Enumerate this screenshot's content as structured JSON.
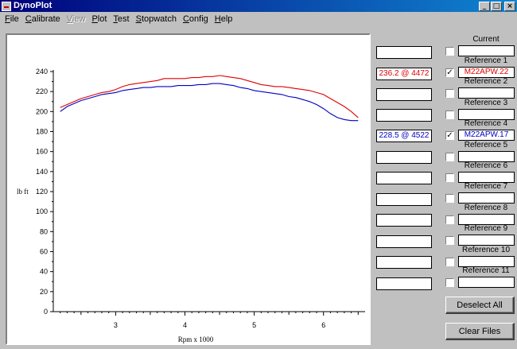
{
  "window": {
    "title": "DynoPlot",
    "min": "_",
    "max": "□",
    "close": "×"
  },
  "menu": [
    {
      "label": "File",
      "u": "F",
      "rest": "ile",
      "disabled": false
    },
    {
      "label": "Calibrate",
      "u": "C",
      "rest": "alibrate",
      "disabled": false
    },
    {
      "label": "View",
      "u": "V",
      "rest": "iew",
      "disabled": true
    },
    {
      "label": "Plot",
      "u": "P",
      "rest": "lot",
      "disabled": false
    },
    {
      "label": "Test",
      "u": "T",
      "rest": "est",
      "disabled": false
    },
    {
      "label": "Stopwatch",
      "u": "S",
      "rest": "topwatch",
      "disabled": false
    },
    {
      "label": "Config",
      "u": "C",
      "rest": "onfig",
      "disabled": false
    },
    {
      "label": "Help",
      "u": "H",
      "rest": "elp",
      "disabled": false
    }
  ],
  "readouts": [
    "",
    "236.2 @ 4472",
    "",
    "",
    "228.5 @ 4522",
    "",
    "",
    "",
    "",
    "",
    "",
    ""
  ],
  "readout_colors": [
    "#000000",
    "#e00000",
    "#000000",
    "#000000",
    "#0000c0",
    "#000000",
    "#000000",
    "#000000",
    "#000000",
    "#000000",
    "#000000",
    "#000000"
  ],
  "current": {
    "label": "Current",
    "value": ""
  },
  "references": [
    {
      "label": "Reference 1",
      "checked": true,
      "value": "M22APW.22",
      "color": "#e00000"
    },
    {
      "label": "Reference 2",
      "checked": false,
      "value": "",
      "color": "#000000"
    },
    {
      "label": "Reference 3",
      "checked": false,
      "value": "",
      "color": "#000000"
    },
    {
      "label": "Reference 4",
      "checked": true,
      "value": "M22APW.17",
      "color": "#0000c0"
    },
    {
      "label": "Reference 5",
      "checked": false,
      "value": "",
      "color": "#000000"
    },
    {
      "label": "Reference 6",
      "checked": false,
      "value": "",
      "color": "#000000"
    },
    {
      "label": "Reference 7",
      "checked": false,
      "value": "",
      "color": "#000000"
    },
    {
      "label": "Reference 8",
      "checked": false,
      "value": "",
      "color": "#000000"
    },
    {
      "label": "Reference 9",
      "checked": false,
      "value": "",
      "color": "#000000"
    },
    {
      "label": "Reference 10",
      "checked": false,
      "value": "",
      "color": "#000000"
    },
    {
      "label": "Reference 11",
      "checked": false,
      "value": "",
      "color": "#000000"
    }
  ],
  "buttons": {
    "deselect_all": "Deselect All",
    "clear_files": "Clear Files"
  },
  "chart_data": {
    "type": "line",
    "xlabel": "Rpm x 1000",
    "ylabel": "lb ft",
    "xlim": [
      2.1,
      6.6
    ],
    "ylim": [
      0,
      240
    ],
    "xticks": [
      3,
      4,
      5,
      6
    ],
    "yticks": [
      0,
      20,
      40,
      60,
      80,
      100,
      120,
      140,
      160,
      180,
      200,
      220,
      240
    ],
    "grid": false,
    "series": [
      {
        "color": "#e00000",
        "x": [
          2.2,
          2.3,
          2.4,
          2.5,
          2.6,
          2.7,
          2.8,
          2.9,
          3.0,
          3.1,
          3.2,
          3.3,
          3.4,
          3.5,
          3.6,
          3.7,
          3.8,
          3.9,
          4.0,
          4.1,
          4.2,
          4.3,
          4.4,
          4.5,
          4.6,
          4.7,
          4.8,
          4.9,
          5.0,
          5.1,
          5.2,
          5.3,
          5.4,
          5.5,
          5.6,
          5.7,
          5.8,
          5.9,
          6.0,
          6.1,
          6.2,
          6.3,
          6.4,
          6.5
        ],
        "y": [
          204,
          207,
          210,
          213,
          215,
          217,
          219,
          220,
          222,
          225,
          227,
          228,
          229,
          230,
          231,
          233,
          233,
          233,
          233,
          234,
          234,
          235,
          235,
          236,
          235,
          234,
          233,
          231,
          229,
          227,
          226,
          225,
          225,
          224,
          223,
          222,
          221,
          219,
          217,
          213,
          209,
          205,
          200,
          194
        ]
      },
      {
        "color": "#0000c0",
        "x": [
          2.2,
          2.3,
          2.4,
          2.5,
          2.6,
          2.7,
          2.8,
          2.9,
          3.0,
          3.1,
          3.2,
          3.3,
          3.4,
          3.5,
          3.6,
          3.7,
          3.8,
          3.9,
          4.0,
          4.1,
          4.2,
          4.3,
          4.4,
          4.5,
          4.6,
          4.7,
          4.8,
          4.9,
          5.0,
          5.1,
          5.2,
          5.3,
          5.4,
          5.5,
          5.6,
          5.7,
          5.8,
          5.9,
          6.0,
          6.1,
          6.2,
          6.3,
          6.4,
          6.5
        ],
        "y": [
          200,
          205,
          208,
          211,
          213,
          215,
          217,
          218,
          219,
          221,
          222,
          223,
          224,
          224,
          225,
          225,
          225,
          226,
          226,
          226,
          227,
          227,
          228,
          228,
          227,
          226,
          224,
          223,
          221,
          220,
          219,
          218,
          217,
          215,
          214,
          212,
          210,
          207,
          203,
          198,
          194,
          192,
          191,
          191
        ]
      }
    ]
  }
}
